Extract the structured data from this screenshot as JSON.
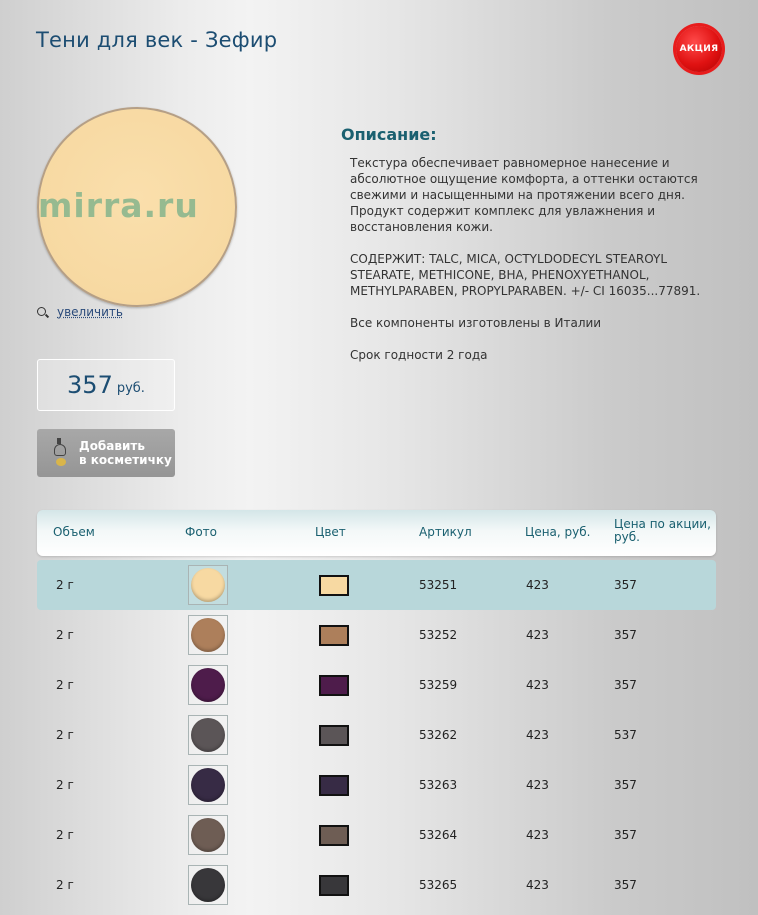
{
  "product": {
    "title": "Тени для век - Зефир",
    "promo_badge": "АКЦИЯ",
    "watermark": "mirra.ru",
    "zoom_label": "увеличить",
    "price": "357",
    "currency": "руб.",
    "cart_label_line1": "Добавить",
    "cart_label_line2": "в косметичку",
    "image_color": "#f7d9a2"
  },
  "description": {
    "heading": "Описание:",
    "p1": "Текстура обеспечивает равномерное нанесение и абсолютное ощущение комфорта, а оттенки остаются свежими и насыщенными на протяжении всего дня. Продукт содержит комплекс для увлажнения и восстановления кожи.",
    "p2": "СОДЕРЖИТ: TALC, MICA, OCTYLDODECYL STEAROYL STEARATE, METHICONE, BHA, PHENOXYETHANOL, METHYLPARABEN, PROPYLPARABEN. +/- CI 16035...77891.",
    "p3": "Все компоненты изготовлены в Италии",
    "p4": "Срок годности 2 года"
  },
  "table": {
    "headers": [
      "Объем",
      "Фото",
      "Цвет",
      "Артикул",
      "Цена, руб.",
      "Цена по акции, руб."
    ],
    "rows": [
      {
        "volume": "2 г",
        "color": "#f7d9a2",
        "sku": "53251",
        "price": "423",
        "promo": "357",
        "selected": true
      },
      {
        "volume": "2 г",
        "color": "#ad7f5b",
        "sku": "53252",
        "price": "423",
        "promo": "357",
        "selected": false
      },
      {
        "volume": "2 г",
        "color": "#4e1c4b",
        "sku": "53259",
        "price": "423",
        "promo": "357",
        "selected": false
      },
      {
        "volume": "2 г",
        "color": "#5b5557",
        "sku": "53262",
        "price": "423",
        "promo": "537",
        "selected": false
      },
      {
        "volume": "2 г",
        "color": "#372b45",
        "sku": "53263",
        "price": "423",
        "promo": "357",
        "selected": false
      },
      {
        "volume": "2 г",
        "color": "#6e5d54",
        "sku": "53264",
        "price": "423",
        "promo": "357",
        "selected": false
      },
      {
        "volume": "2 г",
        "color": "#38373a",
        "sku": "53265",
        "price": "423",
        "promo": "357",
        "selected": false
      }
    ]
  }
}
